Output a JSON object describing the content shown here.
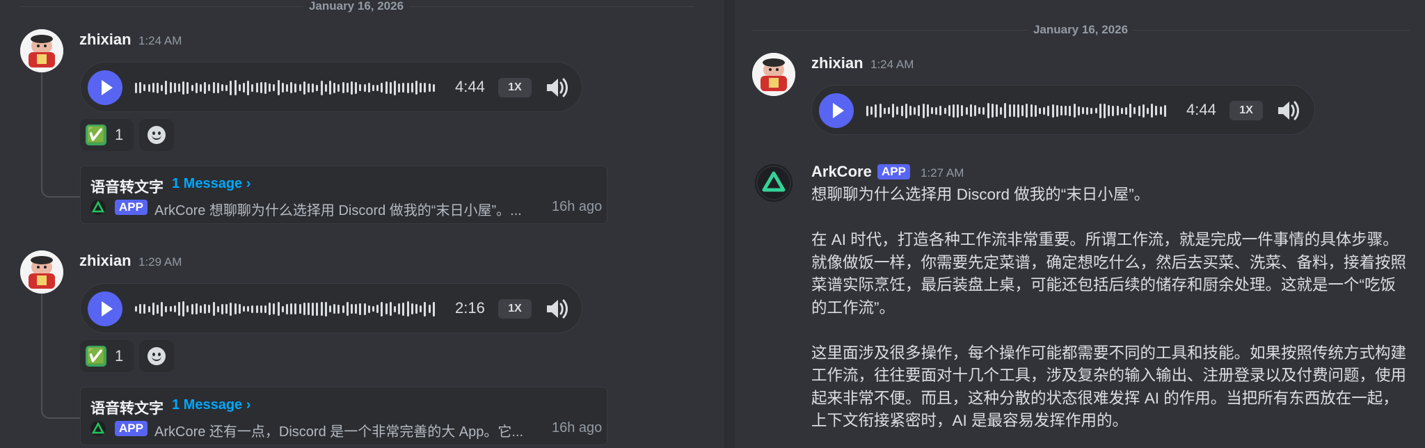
{
  "left": {
    "date_separator": "January 16, 2026",
    "messages": [
      {
        "username": "zhixian",
        "time": "1:24 AM",
        "voice": {
          "duration": "4:44",
          "speed": "1X"
        },
        "reaction": {
          "emoji": "✅",
          "count": "1"
        },
        "thread": {
          "name": "语音转文字",
          "link": "1 Message ›",
          "badge": "APP",
          "preview": "ArkCore 想聊聊为什么选择用 Discord 做我的“末日小屋”。...",
          "ago": "16h ago"
        }
      },
      {
        "username": "zhixian",
        "time": "1:29 AM",
        "voice": {
          "duration": "2:16",
          "speed": "1X"
        },
        "reaction": {
          "emoji": "✅",
          "count": "1"
        },
        "thread": {
          "name": "语音转文字",
          "link": "1 Message ›",
          "badge": "APP",
          "preview": "ArkCore 还有一点，Discord 是一个非常完善的大 App。它...",
          "ago": "16h ago"
        }
      }
    ]
  },
  "right": {
    "date_separator": "January 16, 2026",
    "voice_message": {
      "username": "zhixian",
      "time": "1:24 AM",
      "voice": {
        "duration": "4:44",
        "speed": "1X"
      }
    },
    "bot_message": {
      "username": "ArkCore",
      "badge": "APP",
      "time": "1:27 AM",
      "paragraphs": [
        "想聊聊为什么选择用 Discord 做我的“末日小屋”。",
        "在 AI 时代，打造各种工作流非常重要。所谓工作流，就是完成一件事情的具体步骤。就像做饭一样，你需要先定菜谱，确定想吃什么，然后去买菜、洗菜、备料，接着按照菜谱实际烹饪，最后装盘上桌，可能还包括后续的储存和厨余处理。这就是一个“吃饭的工作流”。",
        "这里面涉及很多操作，每个操作可能都需要不同的工具和技能。如果按照传统方式构建工作流，往往要面对十几个工具，涉及复杂的输入输出、注册登录以及付费问题，使用起来非常不便。而且，这种分散的状态很难发挥 AI 的作用。当把所有东西放在一起，上下文衔接紧密时，AI 是最容易发挥作用的。"
      ]
    }
  },
  "colors": {
    "background": "#313338",
    "accent": "#5865f2",
    "link": "#00a8fc",
    "check": "#3aa55c"
  },
  "icons": [
    "avatar",
    "play-icon",
    "waveform",
    "volume-icon",
    "check-emoji",
    "add-reaction-icon",
    "arkcore-logo-icon"
  ]
}
